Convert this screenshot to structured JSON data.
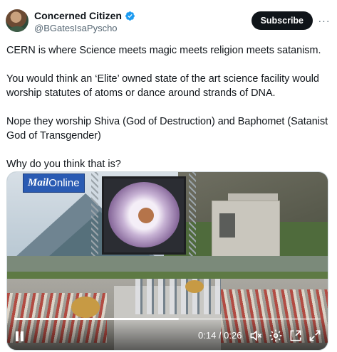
{
  "author": {
    "name": "Concerned Citizen",
    "handle": "@BGatesIsaPyscho",
    "verified": true
  },
  "actions": {
    "subscribe_label": "Subscribe",
    "more_glyph": "···"
  },
  "tweet": {
    "paragraphs": [
      "CERN is where Science meets magic meets religion meets satanism.",
      "You would think an ‘Elite’ owned state of the art science facility would worship statutes of atoms or dance around strands of DNA.",
      "Nope they worship Shiva (God of Destruction) and Baphomet (Satanist God of Transgender)",
      "Why do you think that is?"
    ]
  },
  "video": {
    "watermark_main": "Mail",
    "watermark_sub": "Online",
    "time_display": "0:14 / 0:26",
    "progress_fraction": 0.538,
    "icons": [
      "pause-icon",
      "mute-icon",
      "settings-icon",
      "pip-icon",
      "fullscreen-icon"
    ]
  },
  "colors": {
    "verified_blue": "#1d9bf0",
    "subscribe_bg": "#0f1419",
    "text": "#0f1419",
    "secondary_text": "#536471",
    "watermark_bg": "#2a5bb3"
  }
}
